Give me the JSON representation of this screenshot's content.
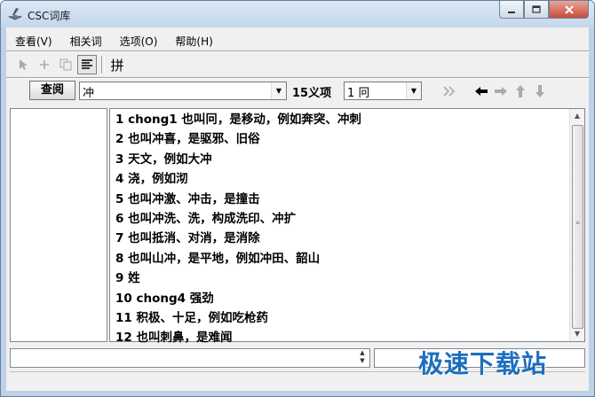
{
  "window": {
    "title": "CSC词库",
    "icons": {
      "app": "book-pen-icon",
      "minimize": "minimize-icon",
      "maximize": "maximize-icon",
      "close": "close-icon"
    }
  },
  "menu": [
    {
      "label": "查看(V)"
    },
    {
      "label": "相关词"
    },
    {
      "label": "选项(O)"
    },
    {
      "label": "帮助(H)"
    }
  ],
  "toolbar1": {
    "pin_label": "拼"
  },
  "toolbar2": {
    "search_label": "查阅",
    "search_value": "冲",
    "count_label": "15义项",
    "sense_value": "1 冋"
  },
  "definitions": [
    "1 chong1 也叫冋，是移动，例如奔突、冲刺",
    "2 也叫冲喜，是驱邪、旧俗",
    "3 天文，例如大冲",
    "4 浇，例如沏",
    "5 也叫冲激、冲击，是撞击",
    "6 也叫冲洗、洗，构成洗印、冲扩",
    "7 也叫抵消、对消，是消除",
    "8 也叫山冲，是平地，例如冲田、韶山",
    "9 姓",
    "10 chong4 强劲",
    "11 积极、十足，例如吃枪药",
    "12 也叫刺鼻，是难闻"
  ],
  "watermark": "极速下载站"
}
